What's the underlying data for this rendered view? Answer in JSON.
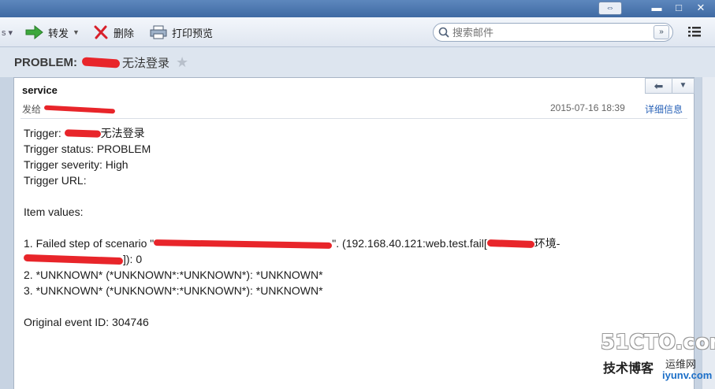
{
  "toolbar": {
    "forward_label": "转发",
    "delete_label": "删除",
    "print_label": "打印预览",
    "search_placeholder": "搜索邮件"
  },
  "header": {
    "subject_prefix": "PROBLEM:",
    "subject_suffix": "无法登录"
  },
  "message": {
    "sender": "service",
    "to_label": "发给",
    "date": "2015-07-16 18:39",
    "details_link": "详细信息",
    "body": {
      "trigger_label": "Trigger: ",
      "trigger_suffix": "无法登录",
      "trigger_status": "Trigger status: PROBLEM",
      "trigger_severity": "Trigger severity: High",
      "trigger_url": "Trigger URL:",
      "item_values": "Item values:",
      "item1_a": "1. Failed step of scenario \"",
      "item1_b": "\". (192.168.40.121:web.test.fail[",
      "item1_c": "环境-",
      "item1_d": "]): 0",
      "item2": "2. *UNKNOWN* (*UNKNOWN*:*UNKNOWN*): *UNKNOWN*",
      "item3": "3. *UNKNOWN* (*UNKNOWN*:*UNKNOWN*): *UNKNOWN*",
      "event_id": "Original event ID: 304746"
    }
  },
  "watermark": {
    "logo": "51CTO.com",
    "sub": "技术博客",
    "right": "运维网",
    "url": "iyunv.com"
  },
  "colors": {
    "accent": "#3f6aa3",
    "redaction": "#e8252a",
    "link": "#2a63b8"
  }
}
